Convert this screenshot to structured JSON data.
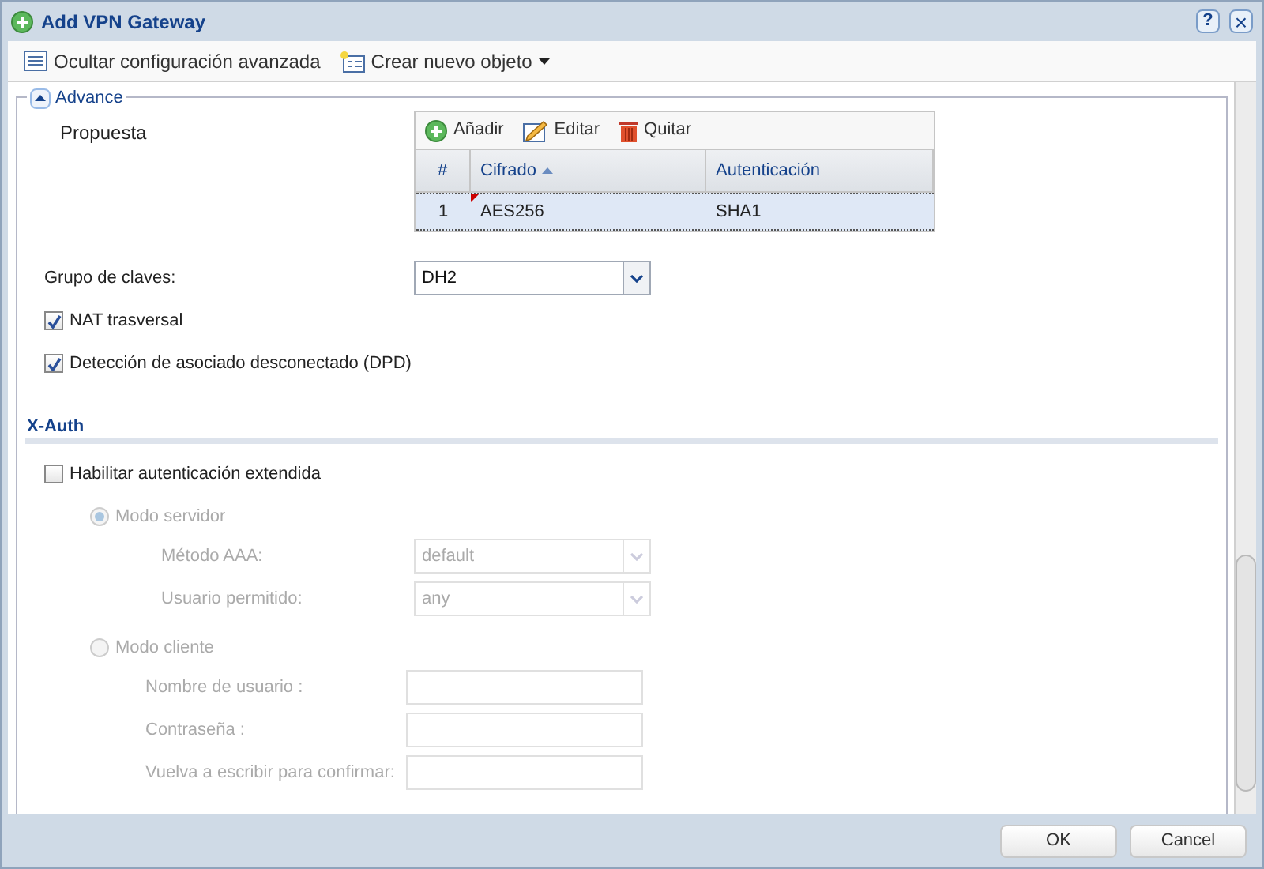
{
  "window": {
    "title": "Add VPN Gateway",
    "help": "?",
    "close": "×"
  },
  "toolbar": [
    {
      "kind": "list",
      "label": "Ocultar configuración avanzada"
    },
    {
      "kind": "new",
      "label": "Crear nuevo objeto",
      "dropdown": true
    }
  ],
  "advance": {
    "legend": "Advance",
    "expanded": true,
    "proposal": {
      "label": "Propuesta",
      "actions": [
        {
          "kind": "add",
          "label": "Añadir"
        },
        {
          "kind": "edit",
          "label": "Editar"
        },
        {
          "kind": "remove",
          "label": "Quitar"
        }
      ],
      "columns": [
        {
          "label": "#",
          "sorted": false
        },
        {
          "label": "Cifrado",
          "sorted": true
        },
        {
          "label": "Autenticación",
          "sorted": false
        }
      ],
      "rows": [
        {
          "cells": [
            "1",
            "AES256",
            "SHA1"
          ],
          "selected": true,
          "modified": true
        }
      ]
    },
    "key_group": {
      "label": "Grupo de claves:",
      "value": "DH2"
    },
    "checkboxes": [
      {
        "label": "NAT trasversal",
        "checked": true
      },
      {
        "label": "Detección de asociado desconectado (DPD)",
        "checked": true
      }
    ]
  },
  "xauth": {
    "title": "X-Auth",
    "enable": {
      "label": "Habilitar autenticación extendida",
      "checked": false
    },
    "modes": [
      {
        "label": "Modo servidor",
        "selected": true,
        "disabled": true,
        "fields": [
          {
            "kind": "select",
            "label": "Método AAA:",
            "value": "default"
          },
          {
            "kind": "select",
            "label": "Usuario permitido:",
            "value": "any"
          }
        ]
      },
      {
        "label": "Modo cliente",
        "selected": false,
        "disabled": true,
        "fields": [
          {
            "kind": "text",
            "label": "Nombre de usuario :"
          },
          {
            "kind": "text",
            "label": "Contraseña :"
          },
          {
            "kind": "text",
            "label": "Vuelva a escribir para confirmar:"
          }
        ]
      }
    ]
  },
  "buttons": [
    "OK",
    "Cancel"
  ]
}
